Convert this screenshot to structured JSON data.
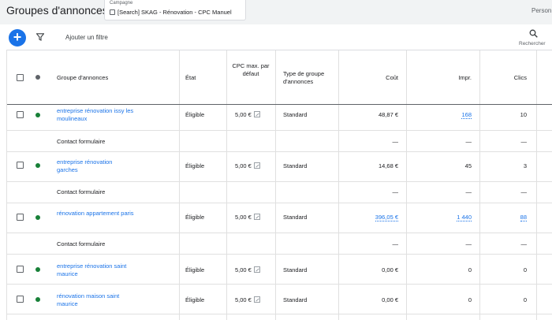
{
  "header": {
    "title": "Groupes d'annonces",
    "campaign_label": "Campagne",
    "campaign_name": "[Search] SKAG - Rénovation - CPC Manuel",
    "person_label": "Person"
  },
  "toolbar": {
    "add_filter": "Ajouter un filtre",
    "search_label": "Rechercher",
    "fab_symbol": "+"
  },
  "table": {
    "columns": {
      "group": "Groupe d'annonces",
      "state": "État",
      "cpc": "CPC max. par défaut",
      "type": "Type de groupe d'annonces",
      "cost": "Coût",
      "impr": "Impr.",
      "clicks": "Clics"
    },
    "rows": [
      {
        "name": "entreprise rénovation issy les moulineaux",
        "state": "Éligible",
        "cpc": "5,00 €",
        "type": "Standard",
        "cost": "48,87 €",
        "impr": "168",
        "clicks": "10",
        "sub": "Contact formulaire",
        "sub_cost": "—",
        "sub_impr": "—",
        "sub_clicks": "—"
      },
      {
        "name": "entreprise rénovation garches",
        "state": "Éligible",
        "cpc": "5,00 €",
        "type": "Standard",
        "cost": "14,68 €",
        "impr": "45",
        "clicks": "3",
        "sub": "Contact formulaire",
        "sub_cost": "—",
        "sub_impr": "—",
        "sub_clicks": "—"
      },
      {
        "name": "rénovation appartement paris",
        "state": "Éligible",
        "cpc": "5,00 €",
        "type": "Standard",
        "cost": "396,05 €",
        "impr": "1 440",
        "clicks": "88",
        "sub": "Contact formulaire",
        "sub_cost": "—",
        "sub_impr": "—",
        "sub_clicks": "—"
      },
      {
        "name": "entreprise rénovation saint maurice",
        "state": "Éligible",
        "cpc": "5,00 €",
        "type": "Standard",
        "cost": "0,00 €",
        "impr": "0",
        "clicks": "0"
      },
      {
        "name": "rénovation maison saint maurice",
        "state": "Éligible",
        "cpc": "5,00 €",
        "type": "Standard",
        "cost": "0,00 €",
        "impr": "0",
        "clicks": "0"
      }
    ]
  },
  "colors": {
    "accent": "#1a73e8",
    "status": "#188038"
  }
}
